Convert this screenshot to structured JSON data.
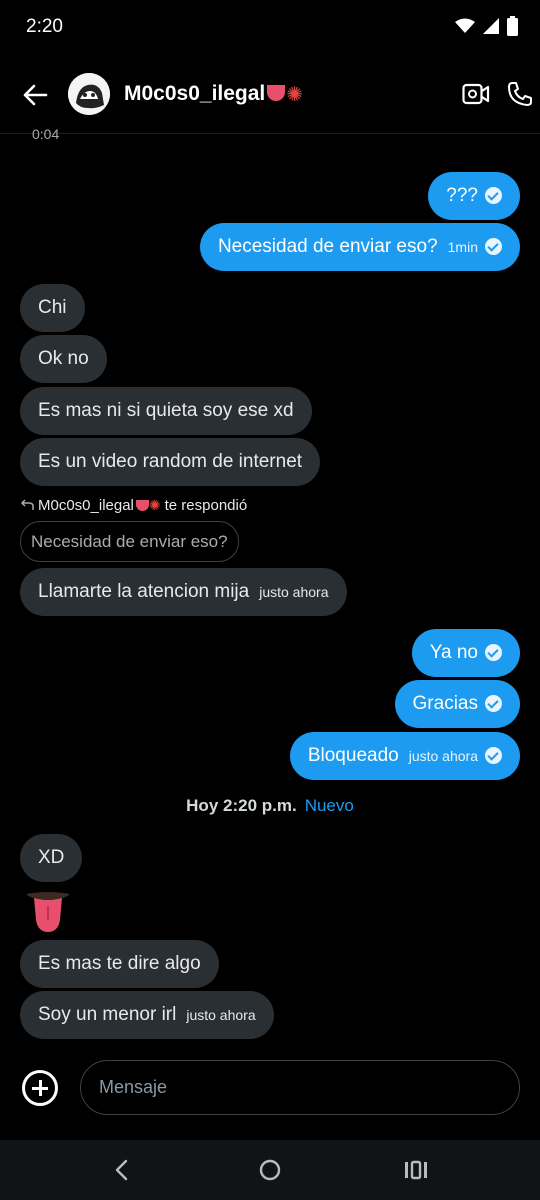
{
  "status": {
    "time": "2:20"
  },
  "header": {
    "contact_name": "M0c0s0_ilegal"
  },
  "partial_timestamp": "0:04",
  "messages": [
    {
      "text": "???",
      "meta": ""
    },
    {
      "text": "Necesidad de enviar eso?",
      "meta": "1min"
    },
    {
      "text": "Chi"
    },
    {
      "text": "Ok no"
    },
    {
      "text": "Es mas ni si quieta soy ese xd"
    },
    {
      "text": "Es un video random de internet"
    },
    {
      "text": "Llamarte la atencion mija",
      "meta": "justo ahora"
    },
    {
      "text": "Ya no"
    },
    {
      "text": "Gracias"
    },
    {
      "text": "Bloqueado",
      "meta": "justo ahora"
    },
    {
      "text": "XD"
    },
    {
      "text": "Es mas te dire algo"
    },
    {
      "text": "Soy un menor irl",
      "meta": "justo ahora"
    }
  ],
  "reply": {
    "author": "M0c0s0_ilegal",
    "suffix": "te respondió",
    "quoted": "Necesidad de enviar eso?"
  },
  "divider": {
    "label": "Hoy 2:20 p.m.",
    "new_label": "Nuevo"
  },
  "composer": {
    "placeholder": "Mensaje"
  },
  "colors": {
    "accent": "#1d9bf0",
    "incoming_bubble": "#2a2f34",
    "background": "#000000"
  },
  "icons": [
    "wifi-icon",
    "signal-icon",
    "battery-icon",
    "back-arrow-icon",
    "video-call-icon",
    "phone-icon",
    "plus-circle-icon",
    "nav-back-icon",
    "nav-home-icon",
    "nav-recents-icon"
  ]
}
